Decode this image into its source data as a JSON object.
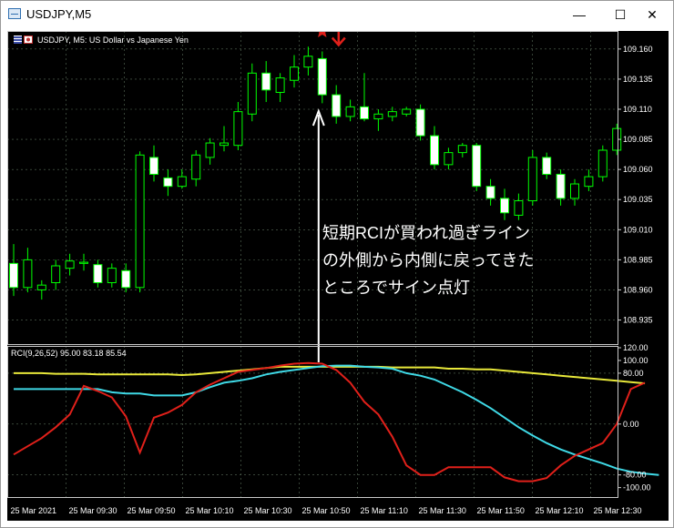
{
  "window": {
    "title": "USDJPY,M5",
    "minimize_glyph": "—",
    "maximize_glyph": "☐",
    "close_glyph": "✕"
  },
  "chart_header": {
    "symbol_text": "USDJPY, M5:  US Dollar vs Japanese Yen",
    "flag_icon": "us-jp-flags-icon"
  },
  "indicator_header": {
    "text": "RCI(9,26,52) 95.00 83.18 85.54"
  },
  "annotation": {
    "lines": [
      "短期RCIが買われ過ぎライン",
      "の外側から内側に戻ってきた",
      "ところでサイン点灯"
    ]
  },
  "colors": {
    "background": "#000000",
    "grid": "#5a6e5a",
    "candle": "#ffffff",
    "candle_up_border": "#00ff00",
    "rci_short": "#e0201a",
    "rci_mid": "#3fd9e6",
    "rci_long": "#e8e83a",
    "signal": "#e0201a"
  },
  "chart_data": [
    {
      "type": "candlestick",
      "symbol": "USDJPY",
      "timeframe": "M5",
      "y_ticks": [
        "109.160",
        "109.135",
        "109.110",
        "109.085",
        "109.060",
        "109.035",
        "109.010",
        "108.985",
        "108.960",
        "108.935"
      ],
      "ylim": [
        108.915,
        109.175
      ],
      "candles": [
        {
          "o": 108.982,
          "h": 108.998,
          "l": 108.955,
          "c": 108.962
        },
        {
          "o": 108.962,
          "h": 108.995,
          "l": 108.958,
          "c": 108.985
        },
        {
          "o": 108.96,
          "h": 108.968,
          "l": 108.952,
          "c": 108.964
        },
        {
          "o": 108.966,
          "h": 108.985,
          "l": 108.96,
          "c": 108.98
        },
        {
          "o": 108.978,
          "h": 108.99,
          "l": 108.972,
          "c": 108.984
        },
        {
          "o": 108.982,
          "h": 108.99,
          "l": 108.976,
          "c": 108.983
        },
        {
          "o": 108.981,
          "h": 108.985,
          "l": 108.962,
          "c": 108.966
        },
        {
          "o": 108.966,
          "h": 108.982,
          "l": 108.962,
          "c": 108.978
        },
        {
          "o": 108.976,
          "h": 108.982,
          "l": 108.958,
          "c": 108.962
        },
        {
          "o": 108.962,
          "h": 109.075,
          "l": 108.958,
          "c": 109.072
        },
        {
          "o": 109.07,
          "h": 109.08,
          "l": 109.05,
          "c": 109.056
        },
        {
          "o": 109.053,
          "h": 109.06,
          "l": 109.038,
          "c": 109.046
        },
        {
          "o": 109.046,
          "h": 109.06,
          "l": 109.044,
          "c": 109.054
        },
        {
          "o": 109.052,
          "h": 109.076,
          "l": 109.046,
          "c": 109.072
        },
        {
          "o": 109.07,
          "h": 109.086,
          "l": 109.064,
          "c": 109.082
        },
        {
          "o": 109.08,
          "h": 109.096,
          "l": 109.075,
          "c": 109.082
        },
        {
          "o": 109.08,
          "h": 109.116,
          "l": 109.076,
          "c": 109.108
        },
        {
          "o": 109.106,
          "h": 109.148,
          "l": 109.1,
          "c": 109.14
        },
        {
          "o": 109.14,
          "h": 109.15,
          "l": 109.116,
          "c": 109.126
        },
        {
          "o": 109.124,
          "h": 109.14,
          "l": 109.116,
          "c": 109.136
        },
        {
          "o": 109.134,
          "h": 109.155,
          "l": 109.128,
          "c": 109.145
        },
        {
          "o": 109.145,
          "h": 109.162,
          "l": 109.138,
          "c": 109.154
        },
        {
          "o": 109.152,
          "h": 109.158,
          "l": 109.115,
          "c": 109.122
        },
        {
          "o": 109.122,
          "h": 109.13,
          "l": 109.098,
          "c": 109.104
        },
        {
          "o": 109.104,
          "h": 109.118,
          "l": 109.1,
          "c": 109.112
        },
        {
          "o": 109.112,
          "h": 109.14,
          "l": 109.1,
          "c": 109.102
        },
        {
          "o": 109.102,
          "h": 109.11,
          "l": 109.092,
          "c": 109.106
        },
        {
          "o": 109.104,
          "h": 109.112,
          "l": 109.1,
          "c": 109.108
        },
        {
          "o": 109.106,
          "h": 109.112,
          "l": 109.104,
          "c": 109.11
        },
        {
          "o": 109.11,
          "h": 109.114,
          "l": 109.084,
          "c": 109.088
        },
        {
          "o": 109.088,
          "h": 109.096,
          "l": 109.06,
          "c": 109.064
        },
        {
          "o": 109.064,
          "h": 109.078,
          "l": 109.06,
          "c": 109.074
        },
        {
          "o": 109.074,
          "h": 109.082,
          "l": 109.07,
          "c": 109.08
        },
        {
          "o": 109.08,
          "h": 109.082,
          "l": 109.042,
          "c": 109.046
        },
        {
          "o": 109.046,
          "h": 109.052,
          "l": 109.03,
          "c": 109.036
        },
        {
          "o": 109.036,
          "h": 109.044,
          "l": 109.018,
          "c": 109.024
        },
        {
          "o": 109.022,
          "h": 109.04,
          "l": 109.018,
          "c": 109.034
        },
        {
          "o": 109.034,
          "h": 109.076,
          "l": 109.03,
          "c": 109.07
        },
        {
          "o": 109.07,
          "h": 109.074,
          "l": 109.052,
          "c": 109.056
        },
        {
          "o": 109.056,
          "h": 109.06,
          "l": 109.03,
          "c": 109.036
        },
        {
          "o": 109.036,
          "h": 109.052,
          "l": 109.03,
          "c": 109.048
        },
        {
          "o": 109.046,
          "h": 109.06,
          "l": 109.042,
          "c": 109.054
        },
        {
          "o": 109.054,
          "h": 109.08,
          "l": 109.05,
          "c": 109.076
        },
        {
          "o": 109.076,
          "h": 109.098,
          "l": 109.072,
          "c": 109.094
        }
      ],
      "signal_candle_index": 22
    },
    {
      "type": "line",
      "indicator": "RCI(9,26,52)",
      "y_ticks": [
        "120.00",
        "100.00",
        "80.00",
        "0.00",
        "-80.00",
        "-100.00"
      ],
      "ylim": [
        -112,
        120
      ],
      "overbought_level": 80,
      "x_ticks": [
        "25 Mar 2021",
        "25 Mar 09:30",
        "25 Mar 09:50",
        "25 Mar 10:10",
        "25 Mar 10:30",
        "25 Mar 10:50",
        "25 Mar 11:10",
        "25 Mar 11:30",
        "25 Mar 11:50",
        "25 Mar 12:10",
        "25 Mar 12:30"
      ],
      "series": [
        {
          "name": "RCI(9)",
          "values": [
            -48,
            -35,
            -22,
            -5,
            15,
            60,
            52,
            42,
            12,
            -45,
            10,
            18,
            30,
            50,
            62,
            72,
            82,
            85,
            88,
            92,
            95,
            96,
            95,
            85,
            65,
            35,
            15,
            -20,
            -65,
            -80,
            -80,
            -68,
            -68,
            -68,
            -68,
            -84,
            -90,
            -90,
            -85,
            -65,
            -50,
            -40,
            -30,
            0,
            55,
            65
          ]
        },
        {
          "name": "RCI(26)",
          "values": [
            55,
            55,
            55,
            55,
            55,
            55,
            55,
            50,
            48,
            48,
            45,
            45,
            45,
            50,
            58,
            65,
            68,
            72,
            78,
            82,
            85,
            88,
            91,
            92,
            92,
            90,
            89,
            87,
            80,
            76,
            70,
            60,
            50,
            38,
            25,
            10,
            -5,
            -18,
            -30,
            -40,
            -48,
            -55,
            -62,
            -70,
            -75,
            -78,
            -80
          ]
        },
        {
          "name": "RCI(52)",
          "values": [
            80,
            80,
            80,
            79,
            79,
            79,
            78,
            78,
            78,
            78,
            78,
            78,
            77,
            78,
            80,
            82,
            84,
            86,
            88,
            90,
            90,
            90,
            90,
            90,
            90,
            90,
            90,
            89,
            89,
            89,
            89,
            87,
            87,
            86,
            86,
            84,
            82,
            80,
            78,
            76,
            74,
            72,
            70,
            68,
            66,
            64
          ]
        }
      ]
    }
  ]
}
